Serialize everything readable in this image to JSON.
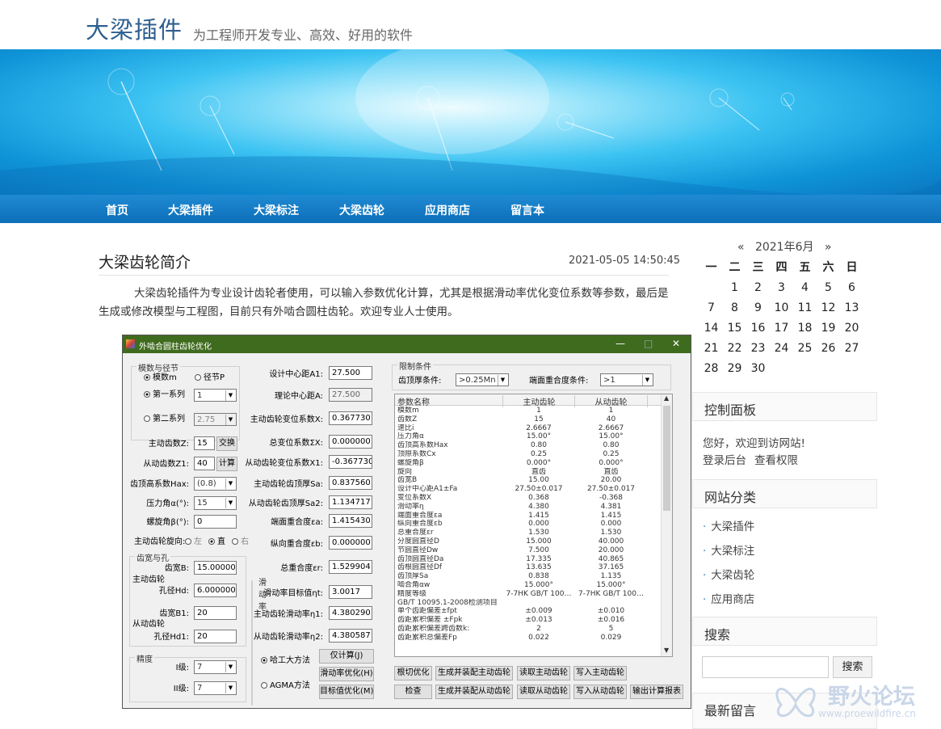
{
  "site": {
    "brand": "大梁插件",
    "tagline": "为工程师开发专业、高效、好用的软件"
  },
  "nav": [
    "首页",
    "大梁插件",
    "大梁标注",
    "大梁齿轮",
    "应用商店",
    "留言本"
  ],
  "post": {
    "title": "大梁齿轮简介",
    "date": "2021-05-05 14:50:45",
    "body": "大梁齿轮插件为专业设计齿轮者使用，可以输入参数优化计算，尤其是根据滑动率优化变位系数等参数，最后是生成或修改模型与工程图，目前只有外啮合圆柱齿轮。欢迎专业人士使用。"
  },
  "app": {
    "title": "外啮合圆柱齿轮优化",
    "controls": [
      "—",
      "□",
      "✕"
    ],
    "grp_module": "模数与径节",
    "r_module": "模数m",
    "r_pitch": "径节P",
    "r_series1": "第一系列",
    "v_series1": "1",
    "r_series2": "第二系列",
    "v_series2": "2.75",
    "l_z": "主动齿数Z:",
    "v_z": "15",
    "b_swap": "交换",
    "l_z1": "从动齿数Z1:",
    "v_z1": "40",
    "b_calc": "计算",
    "l_hax": "齿顶高系数Hax:",
    "v_hax": "(0.8)",
    "l_alpha": "压力角α(°):",
    "v_alpha": "15",
    "l_beta": "螺旋角β(°):",
    "v_beta": "0",
    "l_dir": "主动齿轮旋向:",
    "r_left": "左",
    "r_straight": "直",
    "r_right": "右",
    "grp_width": "齿宽与孔",
    "l_drive": "主动齿轮",
    "l_driven": "从动齿轮",
    "l_b": "齿宽B:",
    "v_b": "15.000000",
    "l_hd": "孔径Hd:",
    "v_hd": "6.000000",
    "l_b1": "齿宽B1:",
    "v_b1": "20",
    "l_hd1": "孔径Hd1:",
    "v_hd1": "20",
    "grp_acc": "精度",
    "l_i": "I级:",
    "v_i": "7",
    "l_ii": "II级:",
    "v_ii": "7",
    "l_a1": "设计中心距A1:",
    "v_a1": "27.500",
    "l_a": "理论中心距A:",
    "v_a": "27.500",
    "l_x": "主动齿轮变位系数X:",
    "v_x": "0.367730",
    "l_sx": "总变位系数ΣX:",
    "v_sx": "0.000000",
    "l_x1": "从动齿轮变位系数X1:",
    "v_x1": "-0.367730",
    "l_sa": "主动齿轮齿顶厚Sa:",
    "v_sa": "0.837560",
    "l_sa2": "从动齿轮齿顶厚Sa2:",
    "v_sa2": "1.134717",
    "l_ea": "端面重合度εa:",
    "v_ea": "1.415430",
    "l_eb": "纵向重合度εb:",
    "v_eb": "0.000000",
    "l_er": "总重合度εr:",
    "v_er": "1.529904",
    "grp_slide": "滑动率",
    "l_target": "滑动率目标值ηt:",
    "v_target": "3.0017",
    "l_eta1": "主动齿轮滑动率η1:",
    "v_eta1": "4.380290",
    "l_eta2": "从动齿轮滑动率η2:",
    "v_eta2": "4.380587",
    "r_hagong": "哈工大方法",
    "r_agma": "AGMA方法",
    "b_only": "仅计算(J)",
    "b_slideopt": "滑动率优化(H)",
    "b_targetopt": "目标值优化(M)",
    "grp_limit": "限制条件",
    "l_topcond": "齿顶厚条件:",
    "v_topcond": ">0.25Mn",
    "l_endcond": "端面重合度条件:",
    "v_endcond": ">1",
    "grid_head": [
      "参数名称",
      "主动齿轮",
      "从动齿轮"
    ],
    "grid_rows": [
      [
        "模数m",
        "1",
        "1"
      ],
      [
        "齿数Z",
        "15",
        "40"
      ],
      [
        "速比i",
        "2.6667",
        "2.6667"
      ],
      [
        "压力角α",
        "15.00°",
        "15.00°"
      ],
      [
        "齿顶高系数Hax",
        "0.80",
        "0.80"
      ],
      [
        "顶隙系数Cx",
        "0.25",
        "0.25"
      ],
      [
        "螺旋角β",
        "0.000°",
        "0.000°"
      ],
      [
        "旋向",
        "直齿",
        "直齿"
      ],
      [
        "齿宽B",
        "15.00",
        "20.00"
      ],
      [
        "设计中心距A1±Fa",
        "27.50±0.017",
        "27.50±0.017"
      ],
      [
        "变位系数X",
        "0.368",
        "-0.368"
      ],
      [
        "滑动率η",
        "4.380",
        "4.381"
      ],
      [
        "端面重合度εa",
        "1.415",
        "1.415"
      ],
      [
        "纵向重合度εb",
        "0.000",
        "0.000"
      ],
      [
        "总重合度εr",
        "1.530",
        "1.530"
      ],
      [
        "分度圆直径D",
        "15.000",
        "40.000"
      ],
      [
        "节圆直径Dw",
        "7.500",
        "20.000"
      ],
      [
        "齿顶圆直径Da",
        "17.335",
        "40.865"
      ],
      [
        "齿根圆直径Df",
        "13.635",
        "37.165"
      ],
      [
        "齿顶厚Sa",
        "0.838",
        "1.135"
      ],
      [
        "啮合角αw",
        "15.000°",
        "15.000°"
      ],
      [
        "精度等级",
        "7-7HK GB/T 100…",
        "7-7HK GB/T 100…"
      ],
      [
        "GB/T 10095.1-2008检测项目",
        "",
        ""
      ],
      [
        "单个齿距偏差±fpt",
        "±0.009",
        "±0.010"
      ],
      [
        "齿距累积偏差 ±Fpk",
        "±0.013",
        "±0.016"
      ],
      [
        "齿距累积偏差跨齿数k:",
        "2",
        "5"
      ],
      [
        "齿距累积总偏差Fp",
        "0.022",
        "0.029"
      ]
    ],
    "b_root": "根切优化",
    "b_gen_drive": "生成并装配主动齿轮",
    "b_read_drive": "读取主动齿轮",
    "b_write_drive": "写入主动齿轮",
    "b_check": "检查",
    "b_gen_driven": "生成并装配从动齿轮",
    "b_read_driven": "读取从动齿轮",
    "b_write_driven": "写入从动齿轮",
    "b_report": "输出计算报表"
  },
  "calendar": {
    "prev": "«",
    "month": "2021年6月",
    "next": "»",
    "weekdays": [
      "一",
      "二",
      "三",
      "四",
      "五",
      "六",
      "日"
    ],
    "days": [
      "",
      "1",
      "2",
      "3",
      "4",
      "5",
      "6",
      "7",
      "8",
      "9",
      "10",
      "11",
      "12",
      "13",
      "14",
      "15",
      "16",
      "17",
      "18",
      "19",
      "20",
      "21",
      "22",
      "23",
      "24",
      "25",
      "26",
      "27",
      "28",
      "29",
      "30"
    ]
  },
  "sidebar": {
    "control_title": "控制面板",
    "welcome": "您好，欢迎到访网站!",
    "login": "登录后台",
    "perm": "查看权限",
    "cat_title": "网站分类",
    "cats": [
      "大梁插件",
      "大梁标注",
      "大梁齿轮",
      "应用商店"
    ],
    "search_title": "搜索",
    "search_btn": "搜索",
    "recent_title": "最新留言"
  },
  "watermark": {
    "name": "野火论坛",
    "url": "www.proewildfire.cn"
  }
}
